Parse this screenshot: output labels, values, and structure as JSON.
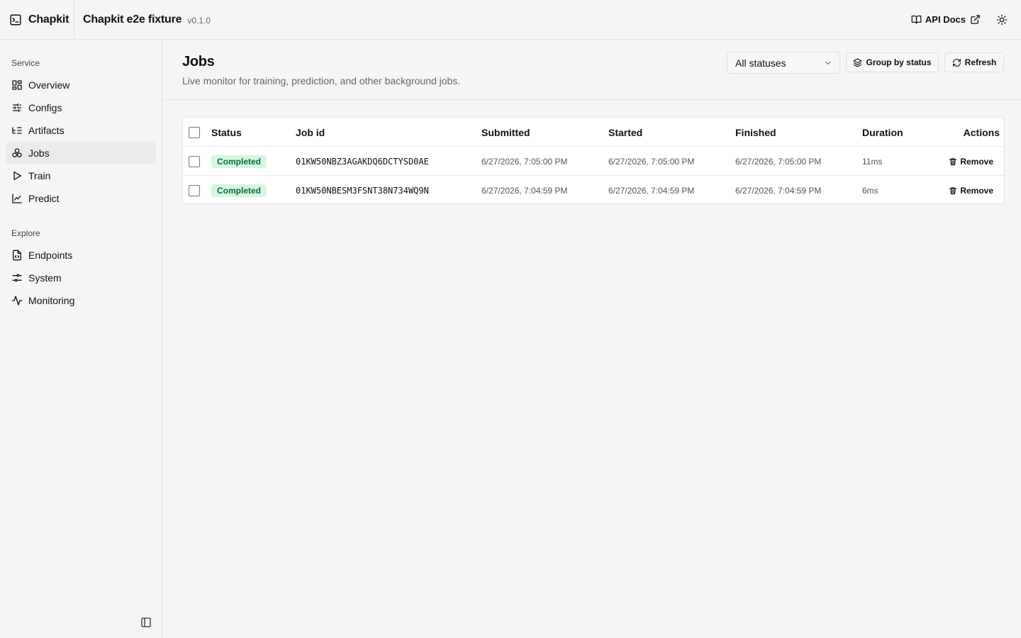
{
  "topbar": {
    "brand": "Chapkit",
    "app_title": "Chapkit e2e fixture",
    "version": "v0.1.0",
    "api_docs_label": "API Docs",
    "icons": [
      "terminal-icon",
      "book-icon",
      "external-link-icon",
      "sun-icon"
    ]
  },
  "sidebar": {
    "service_label": "Service",
    "service_items": [
      {
        "label": "Overview",
        "icon": "layout-grid-icon"
      },
      {
        "label": "Configs",
        "icon": "sliders-icon"
      },
      {
        "label": "Artifacts",
        "icon": "list-tree-icon"
      },
      {
        "label": "Jobs",
        "icon": "boxes-icon",
        "active": true
      },
      {
        "label": "Train",
        "icon": "play-icon"
      },
      {
        "label": "Predict",
        "icon": "line-chart-icon"
      }
    ],
    "explore_label": "Explore",
    "explore_items": [
      {
        "label": "Endpoints",
        "icon": "file-code-icon"
      },
      {
        "label": "System",
        "icon": "settings-toggle-icon"
      },
      {
        "label": "Monitoring",
        "icon": "activity-icon"
      }
    ]
  },
  "page": {
    "title": "Jobs",
    "subtitle": "Live monitor for training, prediction, and other background jobs.",
    "status_filter": "All statuses",
    "group_button": "Group by status",
    "refresh_button": "Refresh"
  },
  "table": {
    "headers": {
      "status": "Status",
      "job_id": "Job id",
      "submitted": "Submitted",
      "started": "Started",
      "finished": "Finished",
      "duration": "Duration",
      "actions": "Actions"
    },
    "rows": [
      {
        "status": "Completed",
        "job_id": "01KW50NBZ3AGAKDQ6DCTYSD0AE",
        "submitted": "6/27/2026, 7:05:00 PM",
        "started": "6/27/2026, 7:05:00 PM",
        "finished": "6/27/2026, 7:05:00 PM",
        "duration": "11ms",
        "action": "Remove"
      },
      {
        "status": "Completed",
        "job_id": "01KW50NBESM3FSNT38N734WQ9N",
        "submitted": "6/27/2026, 7:04:59 PM",
        "started": "6/27/2026, 7:04:59 PM",
        "finished": "6/27/2026, 7:04:59 PM",
        "duration": "6ms",
        "action": "Remove"
      }
    ]
  },
  "colors": {
    "accent_badge_bg": "#d6f5e3",
    "accent_badge_text": "#0d6b36"
  }
}
